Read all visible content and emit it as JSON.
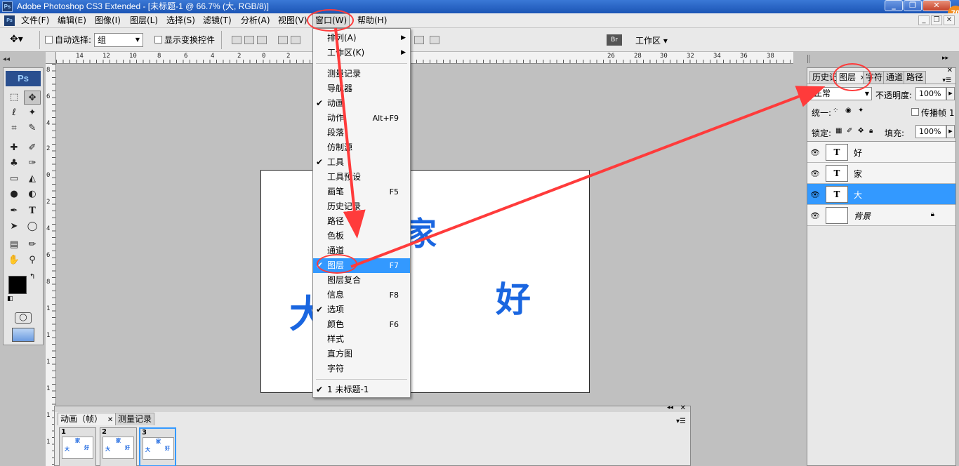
{
  "window": {
    "title": "Adobe Photoshop CS3 Extended - [未标题-1 @ 66.7% (大, RGB/8)]",
    "logo": "Ps",
    "badge": "70"
  },
  "menubar": {
    "items": [
      "文件(F)",
      "编辑(E)",
      "图像(I)",
      "图层(L)",
      "选择(S)",
      "滤镜(T)",
      "分析(A)",
      "视图(V)",
      "窗口(W)",
      "帮助(H)"
    ]
  },
  "options": {
    "auto_select_label": "自动选择:",
    "auto_select_value": "组",
    "show_transform_label": "显示变换控件",
    "workspace_label": "工作区 ▾"
  },
  "ruler": {
    "top_ticks": [
      "14",
      "12",
      "10",
      "8",
      "6",
      "4",
      "2",
      "0",
      "2",
      "4",
      "26",
      "28",
      "30",
      "32",
      "34",
      "36",
      "38"
    ],
    "left_ticks": [
      "8",
      "6",
      "4",
      "2",
      "0",
      "2",
      "4",
      "6",
      "8",
      "1",
      "1",
      "1",
      "1",
      "1",
      "1",
      "2",
      "2"
    ]
  },
  "document": {
    "chars": [
      "家",
      "大",
      "好"
    ]
  },
  "window_menu": {
    "items": [
      {
        "label": "排列(A)",
        "submenu": true
      },
      {
        "label": "工作区(K)",
        "submenu": true
      },
      {
        "label": "测量记录"
      },
      {
        "label": "导航器"
      },
      {
        "label": "动画",
        "checked": true
      },
      {
        "label": "动作",
        "shortcut": "Alt+F9"
      },
      {
        "label": "段落"
      },
      {
        "label": "仿制源"
      },
      {
        "label": "工具",
        "checked": true
      },
      {
        "label": "工具预设"
      },
      {
        "label": "画笔",
        "shortcut": "F5"
      },
      {
        "label": "历史记录"
      },
      {
        "label": "路径"
      },
      {
        "label": "色板"
      },
      {
        "label": "通道"
      },
      {
        "label": "图层",
        "shortcut": "F7",
        "checked": true,
        "highlighted": true
      },
      {
        "label": "图层复合"
      },
      {
        "label": "信息",
        "shortcut": "F8"
      },
      {
        "label": "选项",
        "checked": true
      },
      {
        "label": "颜色",
        "shortcut": "F6"
      },
      {
        "label": "样式"
      },
      {
        "label": "直方图"
      },
      {
        "label": "字符"
      },
      {
        "label": "1 未标题-1",
        "checked": true
      }
    ]
  },
  "layers_panel": {
    "tabs": [
      "历史记",
      "图层",
      "字符",
      "通道",
      "路径"
    ],
    "blend_mode": "正常",
    "opacity_label": "不透明度:",
    "opacity_value": "100%",
    "unify_label": "统一:",
    "propagate_label": "传播帧 1",
    "lock_label": "锁定:",
    "fill_label": "填充:",
    "fill_value": "100%",
    "layers": [
      {
        "name": "好",
        "thumb": "T"
      },
      {
        "name": "家",
        "thumb": "T"
      },
      {
        "name": "大",
        "thumb": "T",
        "selected": true
      },
      {
        "name": "背景",
        "thumb": ""
      }
    ]
  },
  "anim_panel": {
    "tabs": [
      "动画（帧）",
      "测量记录"
    ],
    "frames": [
      "1",
      "2",
      "3"
    ]
  }
}
